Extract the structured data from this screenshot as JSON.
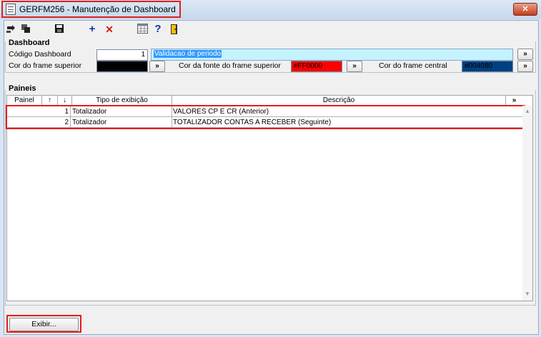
{
  "window": {
    "title": "GERFM256 - Manutenção de Dashboard",
    "close_glyph": "✕"
  },
  "toolbar": {
    "icons": [
      "export-icon",
      "copy-icon",
      "save-icon",
      "add-icon",
      "delete-icon",
      "grid-icon",
      "help-icon",
      "exit-icon"
    ]
  },
  "dashboard": {
    "group_label": "Dashboard",
    "codigo_label": "Código Dashboard",
    "codigo_value": "1",
    "descricao_value": "Validacao de periodo",
    "cor_frame_superior_label": "Cor do frame superior",
    "cor_frame_superior_value": "",
    "cor_fonte_label": "Cor da fonte do frame superior",
    "cor_fonte_value": "#FF0000",
    "cor_frame_central_label": "Cor do frame central",
    "cor_frame_central_value": "#004080",
    "more_glyph": "»"
  },
  "paineis": {
    "group_label": "Paineis",
    "columns": {
      "painel": "Painel",
      "up": "↑",
      "down": "↓",
      "tipo": "Tipo de exibição",
      "descricao": "Descrição",
      "more": "»"
    },
    "rows": [
      {
        "painel": "1",
        "tipo": "Totalizador",
        "descricao": "VALORES CP E CR (Anterior)"
      },
      {
        "painel": "2",
        "tipo": "Totalizador",
        "descricao": "TOTALIZADOR CONTAS A RECEBER (Seguinte)"
      }
    ],
    "scroll_up": "▲",
    "scroll_down": "▼"
  },
  "footer": {
    "exibir_label": "Exibir..."
  },
  "colors": {
    "accent_red": "#e41d1d",
    "selection_blue": "#3399ff",
    "cor_fonte": "#ff0000",
    "cor_central": "#004080",
    "cor_superior": "#000000",
    "desc_field_bg": "#c4f2ff"
  }
}
